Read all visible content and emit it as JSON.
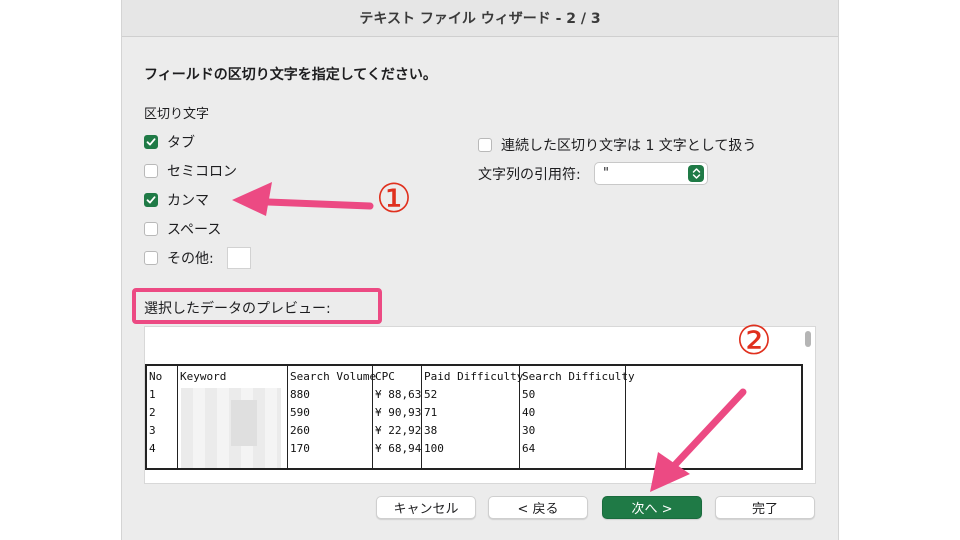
{
  "window": {
    "title": "テキスト ファイル ウィザード - 2 / 3"
  },
  "instruction": "フィールドの区切り文字を指定してください。",
  "delimiters": {
    "group_label": "区切り文字",
    "items": [
      {
        "label": "タブ",
        "checked": true
      },
      {
        "label": "セミコロン",
        "checked": false
      },
      {
        "label": "カンマ",
        "checked": true
      },
      {
        "label": "スペース",
        "checked": false
      },
      {
        "label": "その他:",
        "checked": false
      }
    ],
    "treat_consecutive": {
      "label": "連続した区切り文字は 1 文字として扱う",
      "checked": false
    }
  },
  "text_qualifier": {
    "label": "文字列の引用符:",
    "value": "\""
  },
  "preview": {
    "label": "選択したデータのプレビュー:",
    "headers": [
      "No",
      "Keyword",
      "Search Volume",
      "CPC",
      "Paid Difficulty",
      "Search Difficulty"
    ],
    "rows": [
      [
        "1",
        "",
        "880",
        "¥ 88,63",
        "52",
        "50"
      ],
      [
        "2",
        "",
        "590",
        "¥ 90,93",
        "71",
        "40"
      ],
      [
        "3",
        "",
        "260",
        "¥ 22,92",
        "38",
        "30"
      ],
      [
        "4",
        "",
        "170",
        "¥ 68,94",
        "100",
        "64"
      ]
    ]
  },
  "buttons": {
    "cancel": "キャンセル",
    "back": "< 戻る",
    "next": "次へ >",
    "finish": "完了"
  },
  "annotations": {
    "marker1": "①",
    "marker2": "②"
  },
  "colors": {
    "accent": "#1f7a46",
    "annotation_pink": "#ec4a83",
    "annotation_red": "#e0301e"
  }
}
